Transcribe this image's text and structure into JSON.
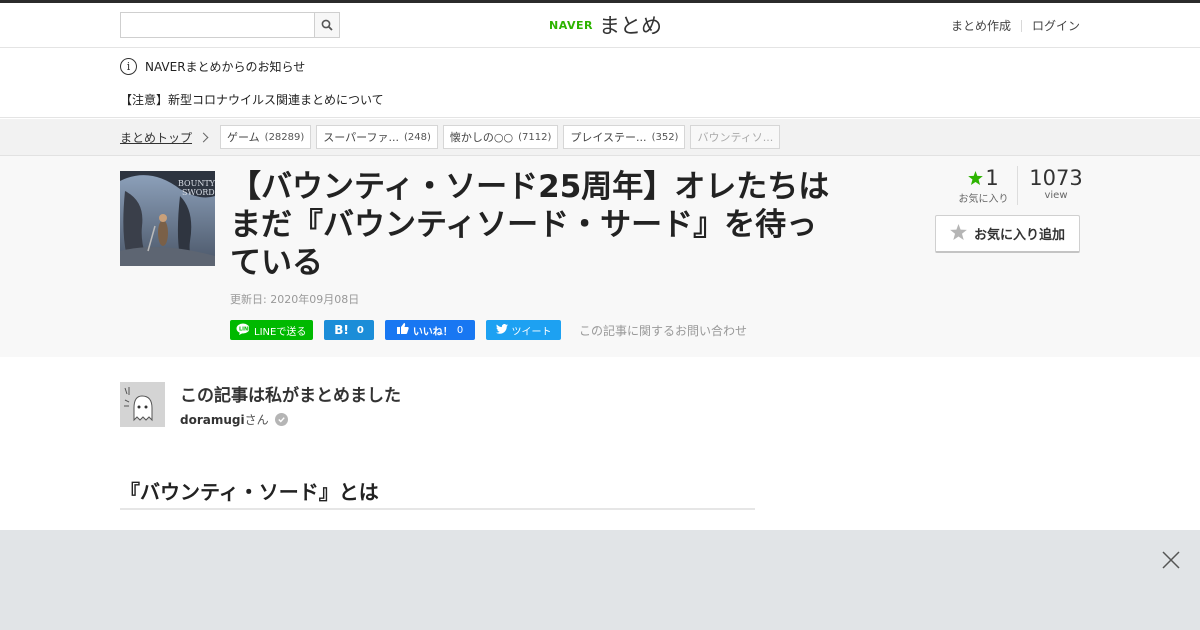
{
  "header": {
    "search": {
      "placeholder": "",
      "value": ""
    },
    "logo_brand": "NAVER",
    "logo_text": "まとめ",
    "links": [
      "まとめ作成",
      "ログイン"
    ]
  },
  "notice": {
    "heading": "NAVERまとめからのお知らせ",
    "link": "【注意】新型コロナウイルス関連まとめについて"
  },
  "breadcrumb": {
    "top": "まとめトップ",
    "tags": [
      {
        "label": "ゲーム",
        "count": "(28289)"
      },
      {
        "label": "スーパーファ...",
        "count": "(248)"
      },
      {
        "label": "懐かしの○○",
        "count": "(7112)"
      },
      {
        "label": "プレイステー...",
        "count": "(352)"
      },
      {
        "label": "バウンティソ...",
        "count": ""
      }
    ]
  },
  "article": {
    "title": "【バウンティ・ソード25周年】オレたちはまだ『バウンティソード・サード』を待っている",
    "updated": "更新日: 2020年09月08日",
    "share": {
      "line": "LINEで送る",
      "hatena_count": "0",
      "facebook": "いいね！",
      "facebook_count": "0",
      "twitter": "ツイート"
    },
    "inquiry": "この記事に関するお問い合わせ",
    "favorites": {
      "count": "1",
      "label": "お気に入り"
    },
    "views": {
      "count": "1073",
      "label": "view"
    },
    "fav_button": "お気に入り追加"
  },
  "author": {
    "heading": "この記事は私がまとめました",
    "name": "doramugi",
    "suffix": "さん"
  },
  "section": {
    "heading": "『バウンティ・ソード』とは"
  },
  "colors": {
    "brand_green": "#2db400",
    "line_green": "#00b900",
    "hatena_blue": "#1b8dd8",
    "facebook_blue": "#1877f2",
    "twitter_blue": "#1da1f2",
    "star_green": "#2db400"
  },
  "icons": [
    "search-icon",
    "info-icon",
    "chevron-right-icon",
    "line-icon",
    "hatena-icon",
    "thumbs-up-icon",
    "twitter-bird-icon",
    "star-icon",
    "verified-check-icon",
    "close-icon"
  ]
}
